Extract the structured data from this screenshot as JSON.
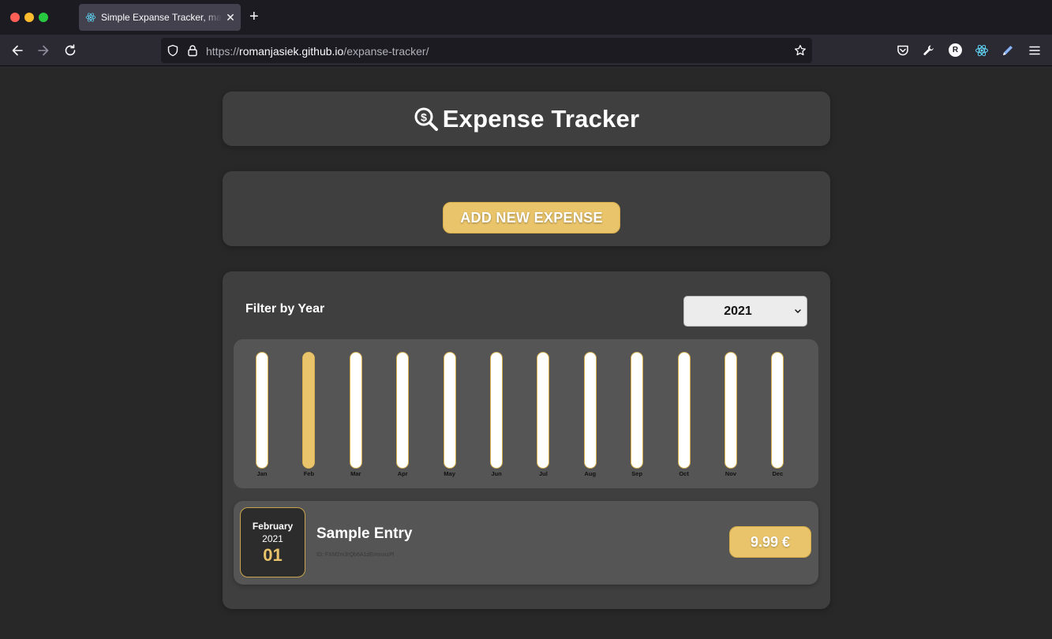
{
  "browser": {
    "tab_title": "Simple Expanse Tracker, made with React",
    "tab_close_label": "✕",
    "new_tab_label": "+",
    "url_prefix": "https://",
    "url_host": "romanjasiek.github.io",
    "url_path": "/expanse-tracker/",
    "icons": [
      "react-icon",
      "back-icon",
      "forward-icon",
      "reload-icon",
      "shield-icon",
      "lock-icon",
      "star-icon",
      "pocket-icon",
      "wrench-icon",
      "profile-icon",
      "react-devtools-icon",
      "pen-icon",
      "menu-icon"
    ],
    "profile_letter": "R"
  },
  "header": {
    "title": "Expense Tracker",
    "logo_icon": "search-dollar-icon"
  },
  "add_expense": {
    "button_label": "ADD NEW EXPENSE"
  },
  "filter": {
    "label": "Filter by Year",
    "selected_year": "2021"
  },
  "chart_data": {
    "type": "bar",
    "categories": [
      "Jan",
      "Feb",
      "Mar",
      "Apr",
      "May",
      "Jun",
      "Jul",
      "Aug",
      "Sep",
      "Oct",
      "Nov",
      "Dec"
    ],
    "values": [
      0,
      9.99,
      0,
      0,
      0,
      0,
      0,
      0,
      0,
      0,
      0,
      0
    ],
    "max_value": 9.99
  },
  "expenses": [
    {
      "month": "February",
      "year": "2021",
      "day": "01",
      "title": "Sample Entry",
      "id_text": "ID: FXM2m3rQb6A1dEmsuxzPl",
      "amount": "9.99 €"
    }
  ],
  "colors": {
    "accent": "#e9c46a",
    "card_bg": "#3f3f3f",
    "inner_bg": "#555555",
    "page_bg": "#282828"
  }
}
